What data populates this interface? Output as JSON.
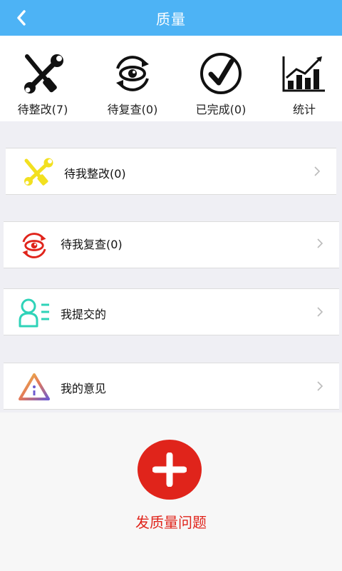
{
  "header": {
    "title": "质量",
    "back_icon": "chevron-left-icon",
    "background": "#4db3f5"
  },
  "stats": [
    {
      "label": "待整改(7)",
      "icon": "wrench-screwdriver-icon"
    },
    {
      "label": "待复查(0)",
      "icon": "eye-review-icon"
    },
    {
      "label": "已完成(0)",
      "icon": "check-circle-icon"
    },
    {
      "label": "统计",
      "icon": "bar-chart-icon"
    }
  ],
  "menu": [
    {
      "label": "待我整改(0)",
      "icon": "tools-icon",
      "icon_color": "#f2e020"
    },
    {
      "label": "待我复查(0)",
      "icon": "eye-review-icon",
      "icon_color": "#e0241b"
    },
    {
      "label": "我提交的",
      "icon": "user-list-icon",
      "icon_color": "#2fd3b8"
    },
    {
      "label": "我的意见",
      "icon": "warning-triangle-icon",
      "icon_color": "#e8a33a"
    }
  ],
  "action": {
    "label": "发质量问题",
    "icon": "plus-icon",
    "color": "#e0241b"
  }
}
